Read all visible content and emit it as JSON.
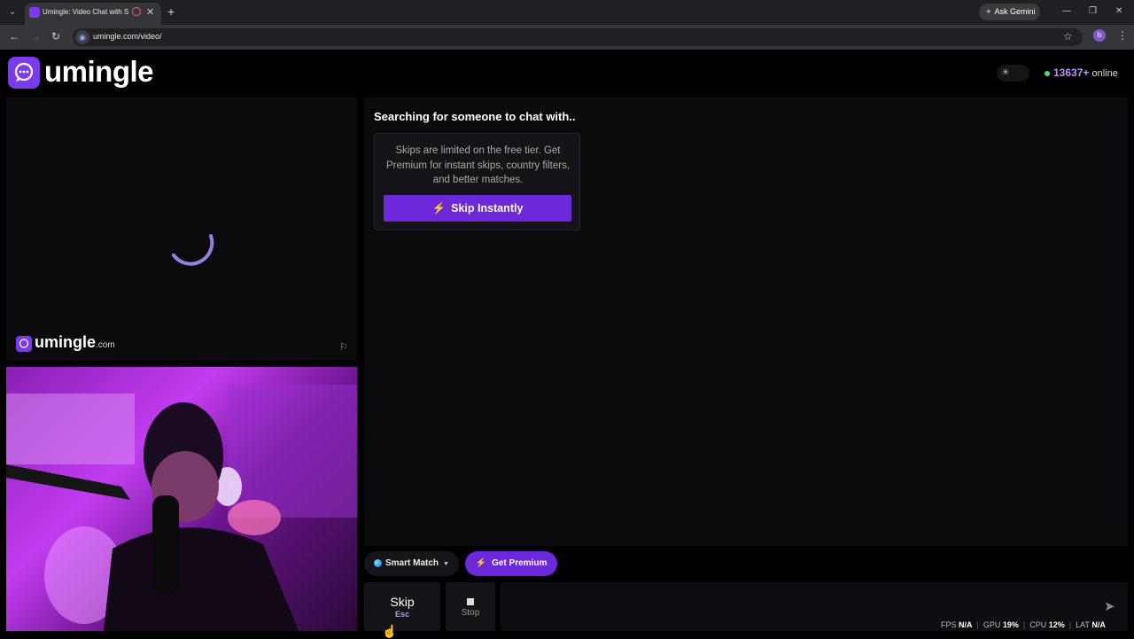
{
  "browser": {
    "tab_title": "Umingle: Video Chat with S",
    "new_tab": "+",
    "close_tab": "✕",
    "ask_gemini": "Ask Gemini",
    "url": "umingle.com/video/",
    "profile_initial": "b"
  },
  "header": {
    "logo_text": "umingle",
    "online_count": "13637+",
    "online_label": "online"
  },
  "remote": {
    "watermark_text": "umingle",
    "watermark_tld": ".com"
  },
  "chat": {
    "status": "Searching for someone to chat with..",
    "card_text": "Skips are limited on the free tier. Get Premium for instant skips, country filters, and better matches.",
    "skip_instantly_label": "Skip Instantly"
  },
  "controls": {
    "smart_match_label": "Smart Match",
    "get_premium_label": "Get Premium",
    "skip_label": "Skip",
    "skip_shortcut": "Esc",
    "stop_label": "Stop"
  },
  "stats": {
    "fps_label": "FPS",
    "fps_value": "N/A",
    "gpu_label": "GPU",
    "gpu_value": "19%",
    "cpu_label": "CPU",
    "cpu_value": "12%",
    "lat_label": "LAT",
    "lat_value": "N/A"
  },
  "colors": {
    "brand": "#7c3aed",
    "button": "#6d28d9",
    "online_dot": "#4ade80",
    "count": "#b794f6"
  }
}
